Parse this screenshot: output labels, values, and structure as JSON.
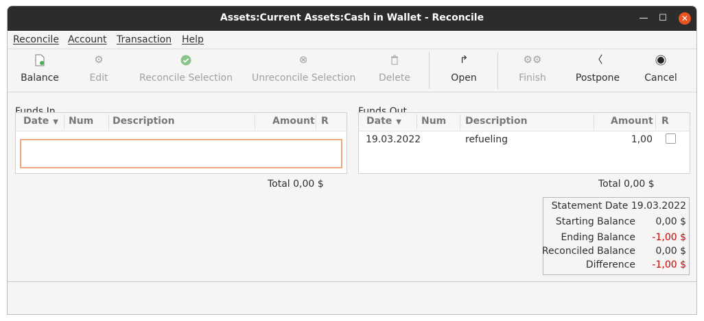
{
  "window": {
    "title": "Assets:Current Assets:Cash in Wallet - Reconcile"
  },
  "menubar": [
    "Reconcile",
    "Account",
    "Transaction",
    "Help"
  ],
  "toolbar": {
    "balance": "Balance",
    "edit": "Edit",
    "reconcile_selection": "Reconcile Selection",
    "unreconcile_selection": "Unreconcile Selection",
    "delete": "Delete",
    "open": "Open",
    "finish": "Finish",
    "postpone": "Postpone",
    "cancel": "Cancel"
  },
  "columns": {
    "date": "Date",
    "num": "Num",
    "description": "Description",
    "amount": "Amount",
    "r": "R"
  },
  "funds_in": {
    "label": "Funds In",
    "rows": [],
    "total": "Total 0,00 $"
  },
  "funds_out": {
    "label": "Funds Out",
    "rows": [
      {
        "date": "19.03.2022",
        "num": "",
        "description": "refueling",
        "amount": "1,00",
        "reconciled": false
      }
    ],
    "total": "Total 0,00 $"
  },
  "summary": {
    "statement_date": "Statement Date 19.03.2022",
    "starting_balance_label": "Starting Balance",
    "starting_balance": "0,00 $",
    "ending_balance_label": "Ending Balance",
    "ending_balance": "-1,00 $",
    "reconciled_balance_label": "Reconciled Balance",
    "reconciled_balance": "0,00 $",
    "difference_label": "Difference",
    "difference": "-1,00 $"
  },
  "colors": {
    "accent": "#e95420",
    "negative": "#cc0000",
    "titlebar": "#2c2c2c"
  }
}
